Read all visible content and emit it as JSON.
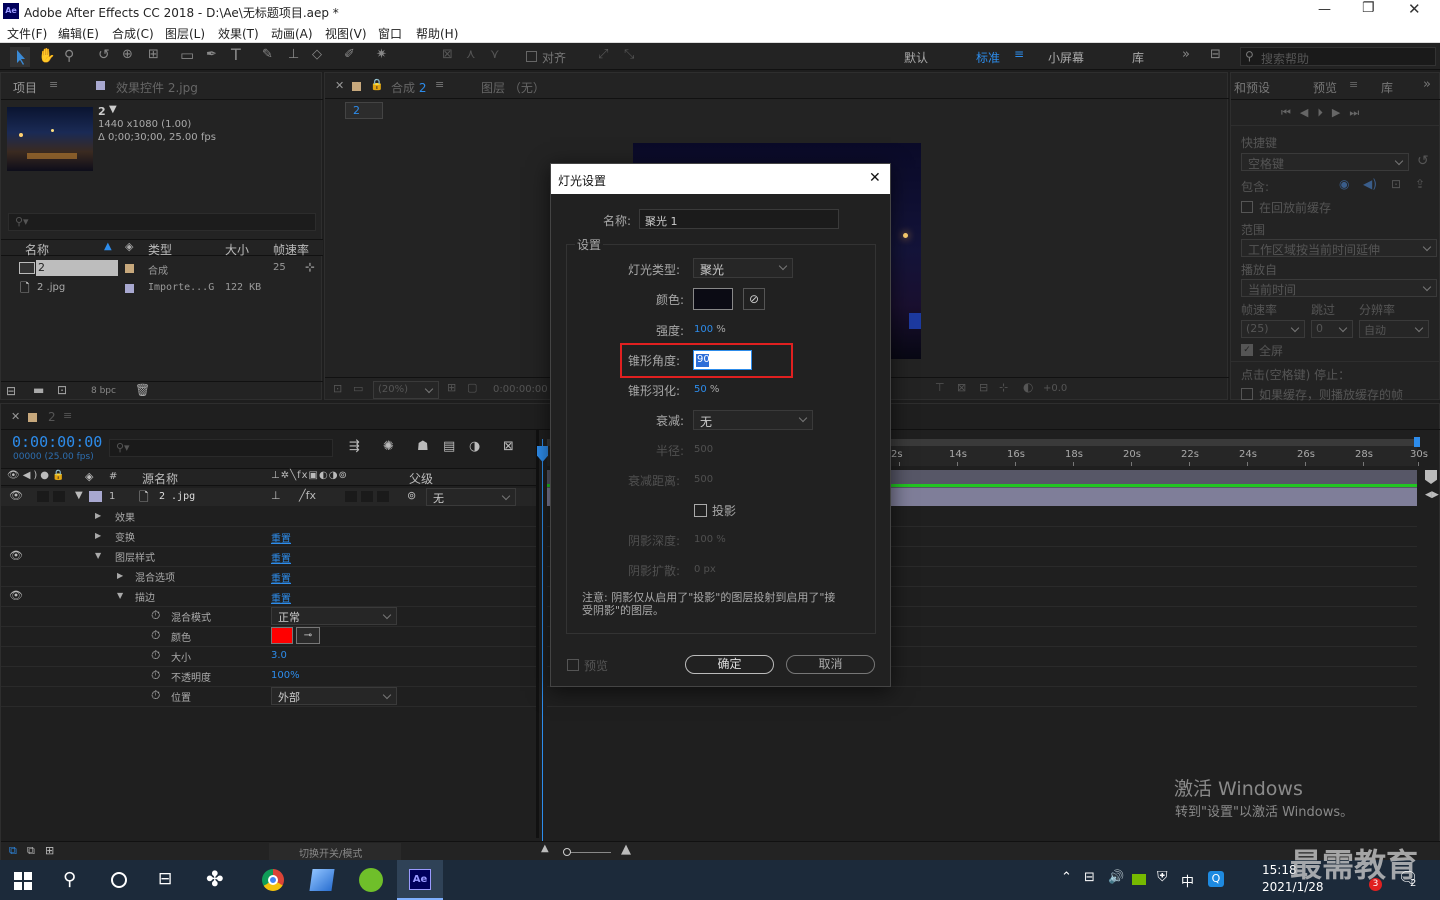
{
  "window": {
    "title": "Adobe After Effects CC 2018 - D:\\Ae\\无标题项目.aep *",
    "app_icon": "Ae"
  },
  "menu": [
    "文件(F)",
    "编辑(E)",
    "合成(C)",
    "图层(L)",
    "效果(T)",
    "动画(A)",
    "视图(V)",
    "窗口",
    "帮助(H)"
  ],
  "toolbar": {
    "align": "对齐",
    "workspaces": [
      "默认",
      "标准",
      "小屏幕",
      "库"
    ],
    "search_placeholder": "搜索帮助"
  },
  "project": {
    "tab": "项目",
    "effects_tab": "效果控件 2.jpg",
    "comp_name": "2",
    "comp_size": "1440 x1080 (1.00)",
    "comp_duration": "Δ 0;00;30;00, 25.00 fps",
    "columns": [
      "名称",
      "类型",
      "大小",
      "帧速率"
    ],
    "items": [
      {
        "name": "2",
        "type": "合成",
        "size": "",
        "fps": "25"
      },
      {
        "name": "2 .jpg",
        "type": "Importe...G",
        "size": "122 KB",
        "fps": ""
      }
    ],
    "bpc": "8 bpc"
  },
  "viewer": {
    "comp_tab": "合成 2",
    "layer_tab": "图层 （无）",
    "crumb": "2",
    "zoom": "(20%)",
    "timecode": "0:00:00:00",
    "exposure": "+0.0"
  },
  "preview": {
    "tab1": "和预设",
    "tab2": "预览",
    "tab3": "库",
    "shortcut_label": "快捷键",
    "shortcut_value": "空格键",
    "include_label": "包含:",
    "cache_before": "在回放前缓存",
    "range_label": "范围",
    "range_value": "工作区域按当前时间延伸",
    "play_from_label": "播放自",
    "play_from_value": "当前时间",
    "fps_label": "帧速率",
    "skip_label": "跳过",
    "resolution_label": "分辨率",
    "fps_value": "(25)",
    "skip_value": "0",
    "resolution_value": "自动",
    "fullscreen": "全屏",
    "stop_label": "点击(空格键) 停止：",
    "if_cached": "如果缓存，则播放缓存的帧"
  },
  "timeline": {
    "tab": "2",
    "timecode": "0:00:00:00",
    "frames": "00000 (25.00 fps)",
    "col_source": "源名称",
    "col_parent": "父级",
    "layer_num": "1",
    "layer_name": "2 .jpg",
    "parent_value": "无",
    "props": {
      "effects": "效果",
      "transform": "变换",
      "layer_styles": "图层样式",
      "blend_options": "混合选项",
      "stroke": "描边",
      "blend_mode": "混合模式",
      "color": "颜色",
      "size": "大小",
      "opacity": "不透明度",
      "position": "位置"
    },
    "reset": "重置",
    "blend_mode_value": "正常",
    "size_value": "3.0",
    "opacity_value": "100%",
    "position_value": "外部",
    "ruler": [
      "2s",
      "14s",
      "16s",
      "18s",
      "20s",
      "22s",
      "24s",
      "26s",
      "28s",
      "30s"
    ],
    "toggle_label": "切换开关/模式",
    "stroke_color": "#ff0000"
  },
  "dialog": {
    "title": "灯光设置",
    "name_label": "名称:",
    "name_value": "聚光 1",
    "settings_label": "设置",
    "light_type_label": "灯光类型:",
    "light_type_value": "聚光",
    "color_label": "颜色:",
    "light_color": "#0b0b14",
    "intensity_label": "强度:",
    "intensity_value": "100",
    "intensity_unit": "%",
    "cone_angle_label": "锥形角度:",
    "cone_angle_value": "90",
    "cone_feather_label": "锥形羽化:",
    "cone_feather_value": "50",
    "cone_feather_unit": "%",
    "falloff_label": "衰减:",
    "falloff_value": "无",
    "radius_label": "半径:",
    "radius_value": "500",
    "falloff_distance_label": "衰减距离:",
    "falloff_distance_value": "500",
    "shadow_label": "投影",
    "shadow_depth_label": "阴影深度:",
    "shadow_depth_value": "100 %",
    "shadow_diffusion_label": "阴影扩散:",
    "shadow_diffusion_value": "0 px",
    "note": "注意: 阴影仅从启用了\"投影\"的图层投射到启用了\"接受阴影\"的图层。",
    "preview_label": "预览",
    "ok_label": "确定",
    "cancel_label": "取消"
  },
  "watermark": {
    "line1": "激活 Windows",
    "line2": "转到\"设置\"以激活 Windows。",
    "brand": "最需教育"
  },
  "taskbar": {
    "time": "15:18",
    "date": "2021/1/28",
    "ime": "中",
    "badge": "3",
    "notif_count": "2"
  }
}
